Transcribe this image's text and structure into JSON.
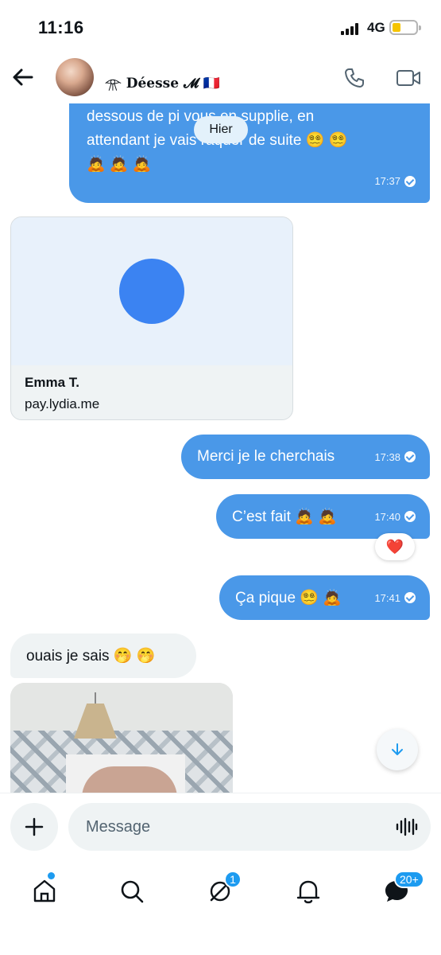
{
  "status_bar": {
    "time": "11:16",
    "network": "4G",
    "battery_level": 0.25
  },
  "header": {
    "contact_name": "𓁿 Déesse 𝓜 🇫🇷",
    "icons": [
      "back-arrow-icon",
      "phone-icon",
      "video-icon"
    ]
  },
  "chat": {
    "date_label": "Hier",
    "messages": {
      "first": {
        "text": "après avec si possible votre visage et vos\ndessous de pi      vous en supplie, en\nattendant je vais raquer de suite 😵‍💫 😵‍💫\n🙇 🙇 🙇",
        "time": "17:37"
      },
      "link_card": {
        "title": "Emma T.",
        "domain": "pay.lydia.me"
      },
      "msg2": {
        "text": "Merci je le cherchais",
        "time": "17:38"
      },
      "msg3": {
        "text": "C’est fait 🙇 🙇",
        "time": "17:40"
      },
      "msg3_reaction": "❤️",
      "msg4": {
        "text": "Ça pique 😵‍💫 🙇",
        "time": "17:41"
      },
      "msg5": {
        "text": "ouais je sais 🤭 🤭"
      }
    }
  },
  "composer": {
    "placeholder": "Message"
  },
  "bottom_nav": {
    "items": [
      "home-icon",
      "search-icon",
      "grok-icon",
      "notifications-icon",
      "messages-icon"
    ],
    "grok_badge": "1",
    "messages_badge": "20+"
  },
  "colors": {
    "outgoing_bubble": "#4a98e8",
    "incoming_bubble": "#eff3f4",
    "accent": "#1d9bf0",
    "heart": "#e0245e"
  }
}
